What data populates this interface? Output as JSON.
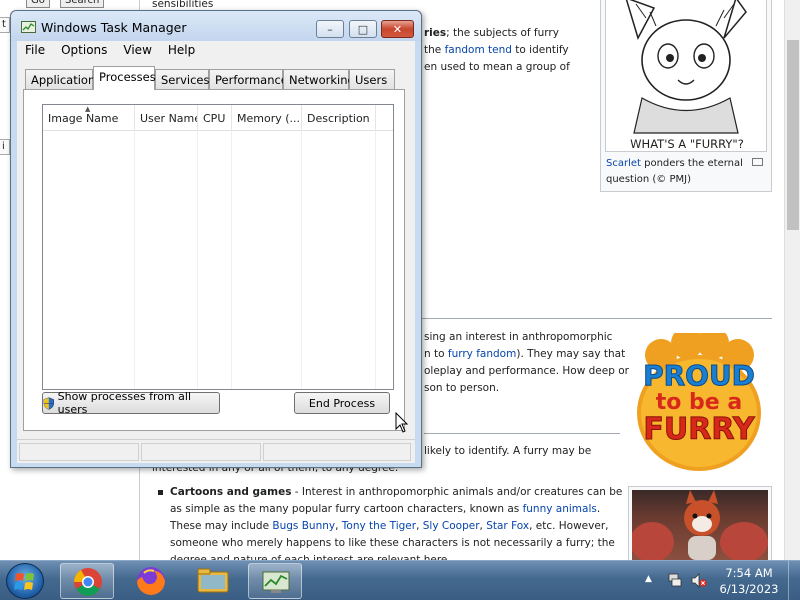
{
  "background_page": {
    "top_left_buttons": [
      "Go",
      "Search"
    ],
    "left_fragments": [
      "t",
      "i"
    ],
    "top_text": "sensibilities",
    "intro_lines": [
      {
        "pre": "",
        "bold": "ries",
        "post": "; the subjects of furry"
      },
      {
        "pre": "the ",
        "link1": "fandom",
        "mid": " ",
        "link2": "tend",
        "post": " to identify"
      },
      {
        "pre": "en used to mean a group of",
        "post": ""
      }
    ],
    "interest_lines": [
      "sing an interest in anthropomorphic",
      {
        "pre": "n to ",
        "link": "furry fandom",
        "post": "). They may say that"
      },
      "oleplay and performance. How deep or",
      "son to person."
    ],
    "identify_lines": [
      "likely to identify. A furry may be",
      "interested in any or all of them, to any degree."
    ],
    "cartoons": {
      "bold": "Cartoons and games",
      "line1": " - Interest in anthropomorphic animals and/or creatures can be",
      "line2_pre": "as simple as the many popular furry cartoon characters, known as ",
      "line2_link": "funny animals",
      "line2_post": ".",
      "line3_pre": "These may include ",
      "links": [
        "Bugs Bunny",
        "Tony the Tiger",
        "Sly Cooper",
        "Star Fox"
      ],
      "line3_post": ", etc. However,",
      "line4": "someone who merely happens to like these characters is not necessarily a furry; the",
      "line5": "degree and nature of each interest are relevant here."
    },
    "comic": {
      "speech_text": "WHAT'S A \"FURRY\"?",
      "caption_link": "Scarlet",
      "caption_rest": " ponders the eternal",
      "caption_line2": "question (© PMJ)"
    },
    "badge": {
      "line1": "PROUD",
      "line2": "to be a",
      "line3": "FURRY"
    }
  },
  "task_manager": {
    "title": "Windows Task Manager",
    "menu": [
      "File",
      "Options",
      "View",
      "Help"
    ],
    "tabs": [
      "Applications",
      "Processes",
      "Services",
      "Performance",
      "Networking",
      "Users"
    ],
    "active_tab": "Processes",
    "columns": [
      "Image Name",
      "User Name",
      "CPU",
      "Memory (...",
      "Description"
    ],
    "rows": [],
    "show_all_button": "Show processes from all users",
    "end_process_button": "End Process",
    "window_controls": {
      "minimize": "–",
      "maximize": "□",
      "close": "✕"
    }
  },
  "taskbar": {
    "apps": [
      "chrome-icon",
      "firefox-icon",
      "file-explorer-icon",
      "task-manager-icon"
    ],
    "clock_time": "7:54 AM",
    "clock_date": "6/13/2023"
  },
  "colors": {
    "link": "#0645ad",
    "taskbar": "#44698f",
    "window_frame": "#c8daf0",
    "close_button": "#c8462e",
    "badge_orange": "#f0a020",
    "badge_blue": "#1a7fd0",
    "badge_red": "#d8281a"
  }
}
